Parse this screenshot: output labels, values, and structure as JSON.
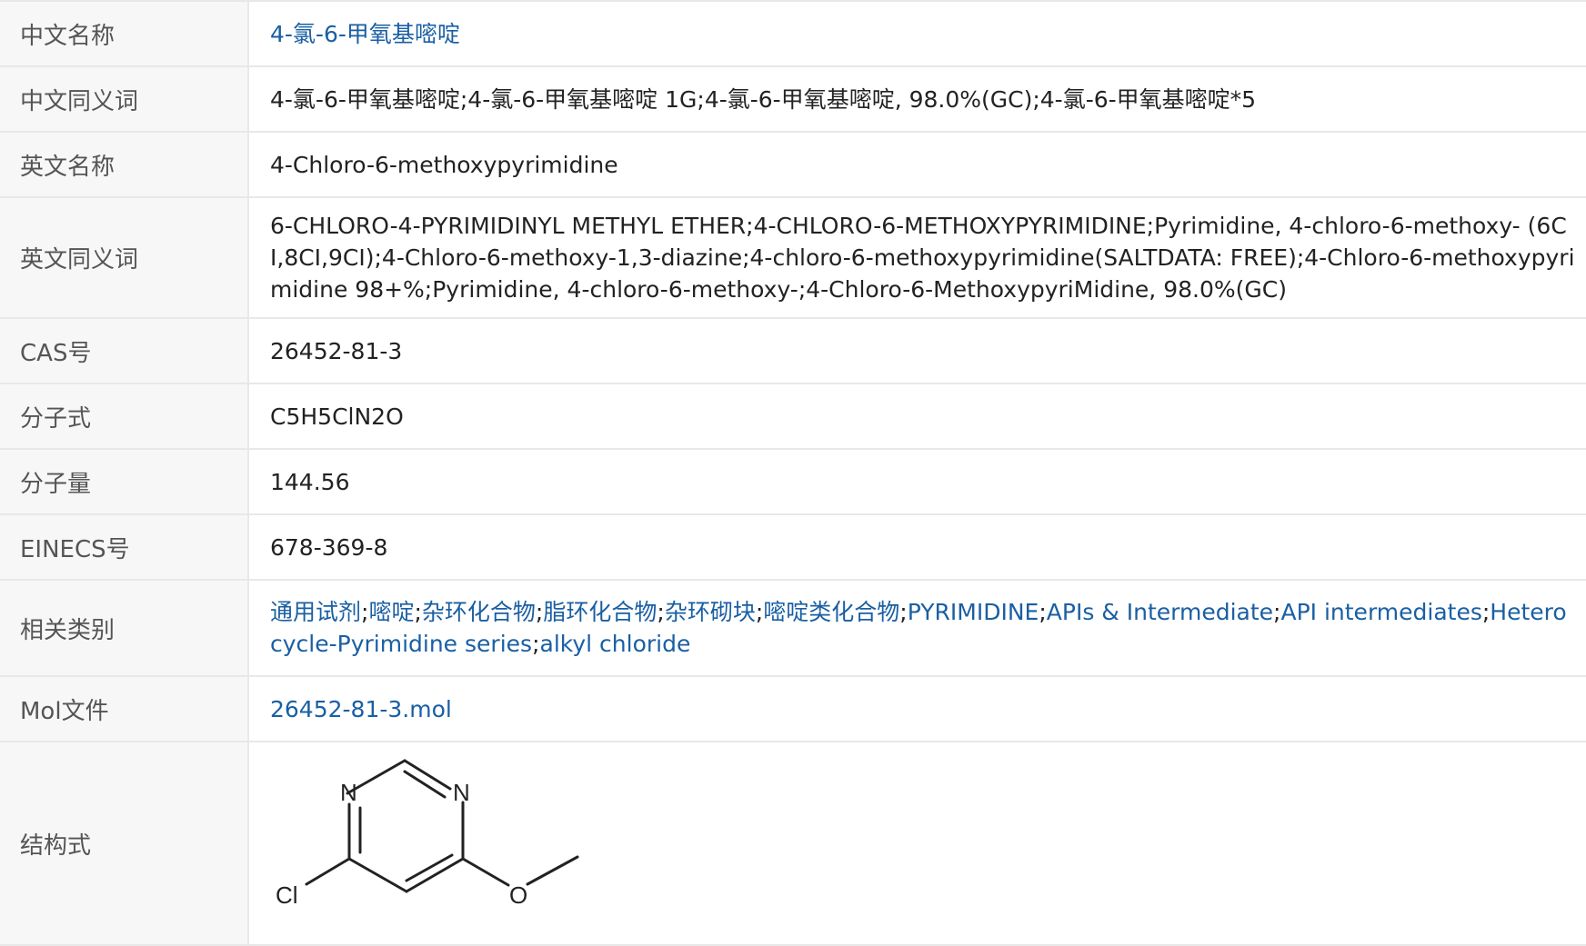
{
  "rows": {
    "cn_name": {
      "label": "中文名称",
      "value": "4-氯-6-甲氧基嘧啶"
    },
    "cn_synonyms": {
      "label": "中文同义词",
      "value": "4-氯-6-甲氧基嘧啶;4-氯-6-甲氧基嘧啶 1G;4-氯-6-甲氧基嘧啶, 98.0%(GC);4-氯-6-甲氧基嘧啶*5"
    },
    "en_name": {
      "label": "英文名称",
      "value": "4-Chloro-6-methoxypyrimidine"
    },
    "en_synonyms": {
      "label": "英文同义词",
      "value": "6-CHLORO-4-PYRIMIDINYL METHYL ETHER;4-CHLORO-6-METHOXYPYRIMIDINE;Pyrimidine, 4-chloro-6-methoxy- (6CI,8CI,9CI);4-Chloro-6-methoxy-1,3-diazine;4-chloro-6-methoxypyrimidine(SALTDATA: FREE);4-Chloro-6-methoxypyrimidine 98+%;Pyrimidine, 4-chloro-6-methoxy-;4-Chloro-6-MethoxypyriMidine, 98.0%(GC)"
    },
    "cas": {
      "label": "CAS号",
      "value": "26452-81-3"
    },
    "formula": {
      "label": "分子式",
      "value": "C5H5ClN2O"
    },
    "mw": {
      "label": "分子量",
      "value": "144.56"
    },
    "einecs": {
      "label": "EINECS号",
      "value": "678-369-8"
    },
    "categories": {
      "label": "相关类别",
      "separator": ";",
      "items": [
        "通用试剂",
        "嘧啶",
        "杂环化合物",
        "脂环化合物",
        "杂环砌块",
        "嘧啶类化合物",
        "PYRIMIDINE",
        "APIs & Intermediate",
        "API intermediates",
        "Heterocycle-Pyrimidine series",
        "alkyl chloride"
      ]
    },
    "mol_file": {
      "label": "Mol文件",
      "value": "26452-81-3.mol"
    },
    "structure": {
      "label": "结构式",
      "atom_labels": {
        "n1": "N",
        "n3": "N",
        "cl": "Cl",
        "o": "O"
      }
    }
  },
  "colors": {
    "link": "#1a5fa3",
    "label_bg": "#f7f7f7",
    "border": "#e8e8e8",
    "text": "#222222",
    "label_text": "#555555"
  }
}
